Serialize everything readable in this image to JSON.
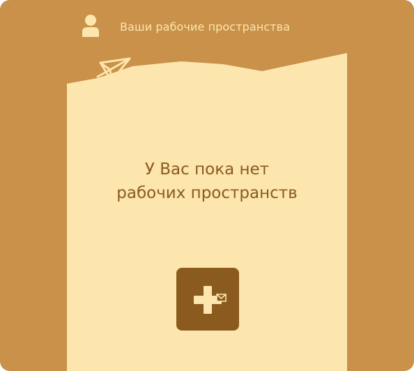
{
  "header": {
    "title": "Ваши рабочие пространства",
    "user_icon": "user-icon"
  },
  "main": {
    "empty_line1": "У Вас пока нет",
    "empty_line2": "рабочих пространств",
    "add_icon": "plus-envelope-icon",
    "corner_icon": "paper-plane-icon"
  },
  "colors": {
    "background": "#C9914A",
    "paper": "#FCE6AD",
    "header_text": "#FCE6AD",
    "message_text": "#8A5A1F",
    "button": "#8A5A1F",
    "button_icon": "#FCE6AD"
  }
}
